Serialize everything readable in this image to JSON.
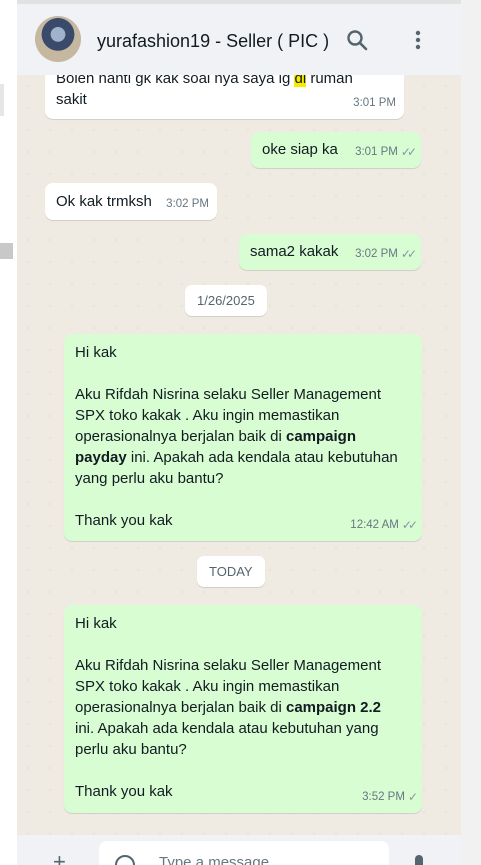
{
  "header": {
    "title": "yurafashion19 - Seller ( PIC )",
    "search_icon": "search-icon",
    "menu_icon": "more-vertical-icon"
  },
  "messages": {
    "m1": {
      "pre": "Boleh nanti gk kak soal nya saya lg ",
      "hl": "di",
      "post": " rumah\nsakit",
      "time": "3:01 PM"
    },
    "m2": {
      "text": "oke siap ka",
      "time": "3:01 PM"
    },
    "m3": {
      "text": "Ok kak trmksh",
      "time": "3:02 PM"
    },
    "m4": {
      "text": "sama2 kakak",
      "time": "3:02 PM"
    },
    "date1": "1/26/2025",
    "m5": {
      "l1": "Hi kak",
      "l2": "Aku Rifdah Nisrina selaku Seller Management\nSPX toko kakak . Aku ingin memastikan\noperasionalnya berjalan baik di ",
      "bold1": "campaign\npayday",
      "l3": " ini. Apakah ada kendala atau kebutuhan\nyang perlu aku bantu?",
      "l4": "Thank you kak",
      "time": "12:42 AM"
    },
    "date2": "TODAY",
    "m6": {
      "l1": "Hi kak",
      "l2": "Aku Rifdah Nisrina selaku Seller Management\nSPX toko kakak . Aku ingin memastikan\noperasionalnya berjalan baik di ",
      "bold1": "campaign 2.2",
      "l3": "\nini. Apakah ada kendala atau kebutuhan yang\nperlu aku bantu?",
      "l4": "Thank you kak",
      "time": "3:52 PM"
    }
  },
  "composer": {
    "placeholder": "Type a message"
  }
}
